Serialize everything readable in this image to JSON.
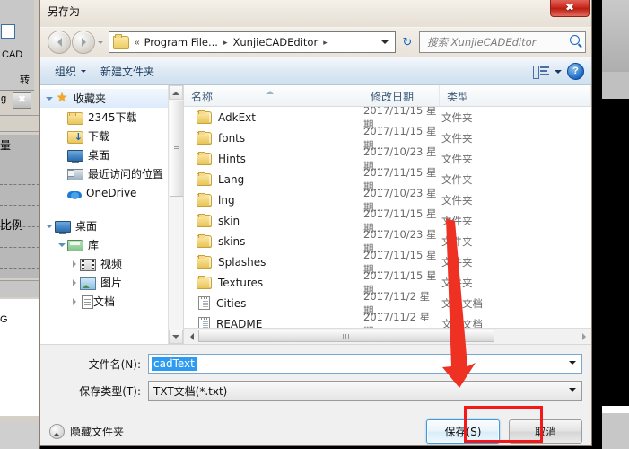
{
  "background_app": {
    "label_cad": "CAD",
    "label_zhuan": "转",
    "label_g": "g",
    "label_liang": "量",
    "label_bili": "比例",
    "label_g2": "G",
    "close_glyph": "✖"
  },
  "dialog": {
    "title": "另存为",
    "close_label": "✖"
  },
  "nav": {
    "back_name": "back",
    "forward_name": "forward",
    "recent_dropdown": "▾",
    "breadcrumbs": [
      {
        "label": "«",
        "type": "overflow"
      },
      {
        "label": "Program File...",
        "type": "crumb"
      },
      {
        "label": "XunjieCADEditor",
        "type": "crumb"
      }
    ],
    "crumb_separator": "▸",
    "address_dropdown": "▾",
    "refresh_glyph": "↻",
    "search_placeholder": "搜索 XunjieCADEditor"
  },
  "commandbar": {
    "organize": "组织",
    "new_folder": "新建文件夹",
    "views_caret": "▾",
    "help_glyph": "?"
  },
  "navpane": {
    "items": [
      {
        "label": "收藏夹",
        "icon": "star-icon",
        "indent": 0,
        "twisty": "open",
        "selected": true
      },
      {
        "label": "2345下载",
        "icon": "folder-icon",
        "indent": 1,
        "twisty": "none",
        "selected": false
      },
      {
        "label": "下载",
        "icon": "downloads-icon",
        "indent": 1,
        "twisty": "none",
        "selected": false
      },
      {
        "label": "桌面",
        "icon": "desktop-icon",
        "indent": 1,
        "twisty": "none",
        "selected": false
      },
      {
        "label": "最近访问的位置",
        "icon": "recent-places-icon",
        "indent": 1,
        "twisty": "none",
        "selected": false
      },
      {
        "label": "OneDrive",
        "icon": "cloud-icon",
        "indent": 1,
        "twisty": "none",
        "selected": false
      },
      {
        "label": "",
        "icon": "spacer",
        "indent": 0,
        "twisty": "none",
        "selected": false
      },
      {
        "label": "桌面",
        "icon": "desktop-icon",
        "indent": 0,
        "twisty": "open",
        "selected": false
      },
      {
        "label": "库",
        "icon": "library-icon",
        "indent": 1,
        "twisty": "open",
        "selected": false
      },
      {
        "label": "视频",
        "icon": "video-icon",
        "indent": 2,
        "twisty": "closed",
        "selected": false
      },
      {
        "label": "图片",
        "icon": "picture-icon",
        "indent": 2,
        "twisty": "closed",
        "selected": false
      },
      {
        "label": "文档",
        "icon": "document-icon",
        "indent": 2,
        "twisty": "closed",
        "selected": false
      }
    ]
  },
  "filelist": {
    "columns": [
      "名称",
      "修改日期",
      "类型"
    ],
    "rows": [
      {
        "name": "AdkExt",
        "date": "2017/11/15 星期...",
        "type": "文件夹",
        "icon": "folder-icon"
      },
      {
        "name": "fonts",
        "date": "2017/11/15 星期...",
        "type": "文件夹",
        "icon": "folder-icon"
      },
      {
        "name": "Hints",
        "date": "2017/10/23 星期...",
        "type": "文件夹",
        "icon": "folder-icon"
      },
      {
        "name": "Lang",
        "date": "2017/11/15 星期...",
        "type": "文件夹",
        "icon": "folder-icon"
      },
      {
        "name": "lng",
        "date": "2017/10/23 星期...",
        "type": "文件夹",
        "icon": "folder-icon"
      },
      {
        "name": "skin",
        "date": "2017/11/15 星期...",
        "type": "文件夹",
        "icon": "folder-icon"
      },
      {
        "name": "skins",
        "date": "2017/10/23 星期...",
        "type": "文件夹",
        "icon": "folder-icon"
      },
      {
        "name": "Splashes",
        "date": "2017/11/15 星期...",
        "type": "文件夹",
        "icon": "folder-icon"
      },
      {
        "name": "Textures",
        "date": "2017/11/15 星期...",
        "type": "文件夹",
        "icon": "folder-icon"
      },
      {
        "name": "Cities",
        "date": "2017/11/2 星期...",
        "type": "文本文档",
        "icon": "text-file-icon"
      },
      {
        "name": "README",
        "date": "2017/11/2 星期...",
        "type": "文本文档",
        "icon": "text-file-icon"
      }
    ]
  },
  "form": {
    "filename_label": "文件名(N):",
    "filename_value": "cadText",
    "savetype_label": "保存类型(T):",
    "savetype_value": "TXT文档(*.txt)",
    "dropdown_caret": "▾"
  },
  "footer": {
    "hide_folders": "隐藏文件夹",
    "save_button": "保存(S)",
    "cancel_button": "取消"
  },
  "annotation": {
    "arrow_color": "#ef3124",
    "highlight_color": "#f41818"
  }
}
